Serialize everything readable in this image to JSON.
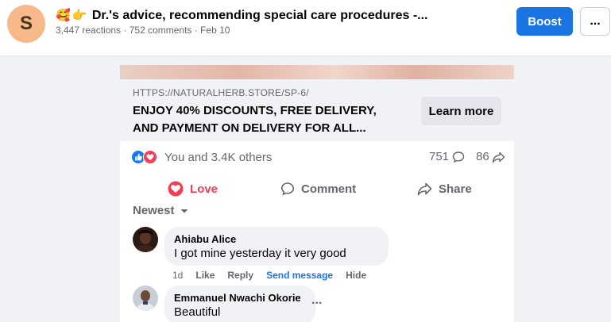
{
  "header": {
    "page_initial": "S",
    "title_emojis": [
      "🥰",
      "👉"
    ],
    "title": "Dr.'s advice, recommending special care procedures -...",
    "meta": "3,447 reactions · 752 comments · Feb 10",
    "boost_label": "Boost",
    "more_label": "..."
  },
  "link_preview": {
    "url": "HTTPS://NATURALHERB.STORE/SP-6/",
    "headline": "ENJOY 40% DISCOUNTS, FREE DELIVERY, AND PAYMENT ON DELIVERY FOR ALL...",
    "cta_label": "Learn more"
  },
  "reactions": {
    "summary": "You and 3.4K others",
    "comments_count": "751",
    "shares_count": "86",
    "icons": [
      "like-icon",
      "love-icon"
    ]
  },
  "actions": {
    "love": "Love",
    "comment": "Comment",
    "share": "Share"
  },
  "comments": {
    "sort_label": "Newest",
    "items": [
      {
        "name": "Ahiabu Alice",
        "text": "I got mine yesterday it very good",
        "time": "1d",
        "like": "Like",
        "reply": "Reply",
        "send": "Send message",
        "hide": "Hide"
      },
      {
        "name": "Emmanuel Nwachi Okorie",
        "text": "Beautiful",
        "more": "..."
      }
    ]
  },
  "colors": {
    "accent": "#1b74e4",
    "love": "#f33e58",
    "muted": "#65676b"
  }
}
